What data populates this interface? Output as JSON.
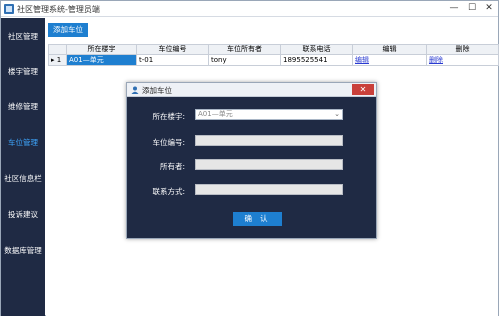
{
  "window": {
    "title": "社区管理系统-管理员端",
    "minimize": "—",
    "maximize": "☐",
    "close": "✕"
  },
  "sidebar": {
    "items": [
      {
        "label": "社区管理"
      },
      {
        "label": "楼宇管理"
      },
      {
        "label": "维修管理"
      },
      {
        "label": "车位管理"
      },
      {
        "label": "社区信息栏"
      },
      {
        "label": "投诉建议"
      },
      {
        "label": "数据库管理"
      }
    ],
    "active_index": 3
  },
  "toolbar": {
    "add_label": "添加车位"
  },
  "grid": {
    "columns": [
      "所在楼宇",
      "车位编号",
      "车位所有者",
      "联系电话",
      "编辑",
      "删除"
    ],
    "rows": [
      {
        "indicator": "▸ 1",
        "building": "A01—单元",
        "space_no": "t-01",
        "owner": "tony",
        "phone": "1895525541",
        "edit": "编辑",
        "delete": "删除"
      }
    ]
  },
  "dialog": {
    "title": "添加车位",
    "close": "✕",
    "building_label": "所在楼宇:",
    "building_value": "A01—单元",
    "space_label": "车位编号:",
    "space_value": "",
    "owner_label": "所有者:",
    "owner_value": "",
    "phone_label": "联系方式:",
    "phone_value": "",
    "confirm_label": "确 认"
  },
  "colors": {
    "accent": "#1e7fd0",
    "sidebar_bg": "#1f2a44",
    "active_nav": "#3ea7ff",
    "close_red": "#c9403a"
  }
}
